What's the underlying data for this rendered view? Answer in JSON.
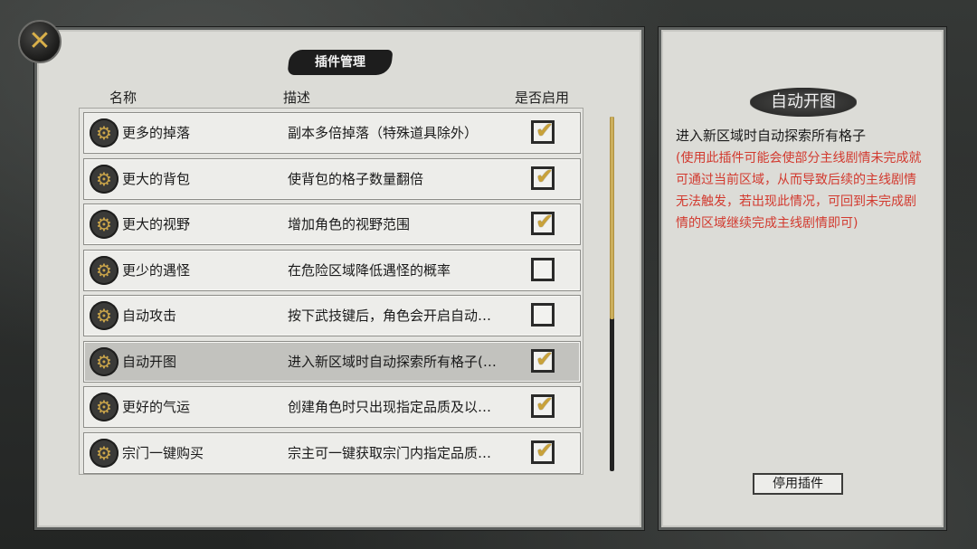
{
  "dialog_title": "插件管理",
  "headers": {
    "name": "名称",
    "description": "描述",
    "enabled": "是否启用"
  },
  "plugins": [
    {
      "name": "更多的掉落",
      "description": "副本多倍掉落（特殊道具除外）",
      "enabled": true
    },
    {
      "name": "更大的背包",
      "description": "使背包的格子数量翻倍",
      "enabled": true
    },
    {
      "name": "更大的视野",
      "description": "增加角色的视野范围",
      "enabled": true
    },
    {
      "name": "更少的遇怪",
      "description": "在危险区域降低遇怪的概率",
      "enabled": false
    },
    {
      "name": "自动攻击",
      "description": "按下武技键后，角色会开启自动…",
      "enabled": false
    },
    {
      "name": "自动开图",
      "description": "进入新区域时自动探索所有格子(…",
      "enabled": true,
      "selected": true
    },
    {
      "name": "更好的气运",
      "description": "创建角色时只出现指定品质及以…",
      "enabled": true
    },
    {
      "name": "宗门一键购买",
      "description": "宗主可一键获取宗门内指定品质…",
      "enabled": true
    }
  ],
  "detail": {
    "title": "自动开图",
    "summary": "进入新区域时自动探索所有格子",
    "warning": "(使用此插件可能会使部分主线剧情未完成就可通过当前区域，从而导致后续的主线剧情无法触发，若出现此情况，可回到未完成剧情的区域继续完成主线剧情即可)",
    "button_label": "停用插件"
  },
  "scroll_position": 0.0,
  "colors": {
    "accent_gold": "#c9a23a",
    "warning_red": "#d23a2f"
  },
  "icons": {
    "close": "close-x-icon",
    "plugin": "gear-icon",
    "check": "checkmark-icon"
  }
}
